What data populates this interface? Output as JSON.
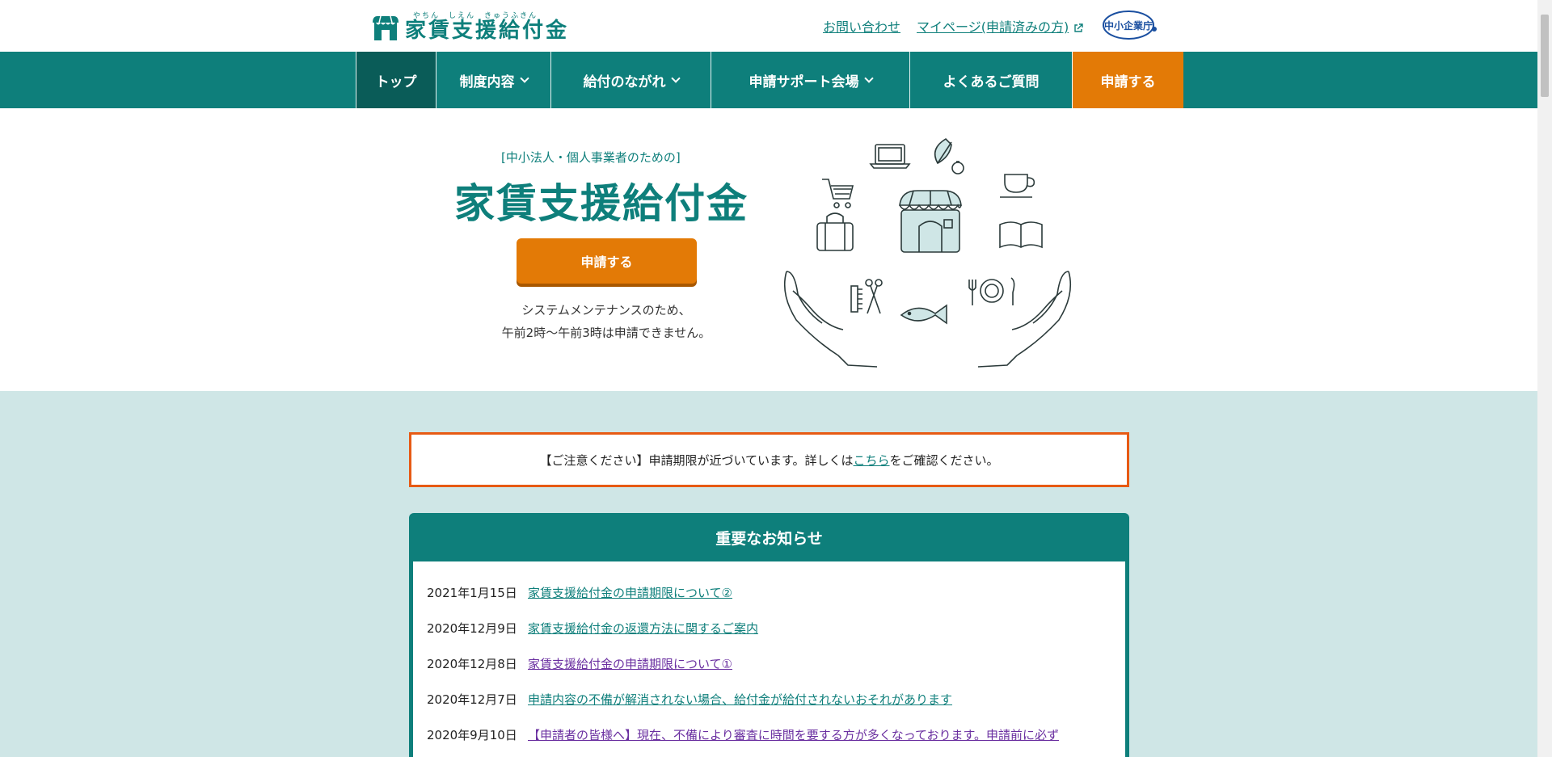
{
  "header": {
    "logo_ruby": "やちん　しえん　きゅうふきん",
    "logo_title": "家賃支援給付金",
    "contact_link": "お問い合わせ",
    "mypage_link": "マイページ(申請済みの方)",
    "agency_badge": "中小企業庁"
  },
  "nav": {
    "items": [
      {
        "label": "トップ"
      },
      {
        "label": "制度内容"
      },
      {
        "label": "給付のながれ"
      },
      {
        "label": "申請サポート会場"
      },
      {
        "label": "よくあるご質問"
      },
      {
        "label": "申請する"
      }
    ],
    "active_color": "#0a5c58",
    "bar_color": "#0e7f7b",
    "apply_color": "#e37a06"
  },
  "hero": {
    "subtitle": "[中小法人・個人事業者のための]",
    "title": "家賃支援給付金",
    "apply_button": "申請する",
    "note_line1": "システムメンテナンスのため、",
    "note_line2": "午前2時〜午前3時は申請できません。"
  },
  "notice": {
    "prefix": "【ご注意ください】申請期限が近づいています。詳しくは",
    "link": "こちら",
    "suffix": "をご確認ください。"
  },
  "news": {
    "title": "重要なお知らせ",
    "items": [
      {
        "date": "2021年1月15日",
        "text": "家賃支援給付金の申請期限について②"
      },
      {
        "date": "2020年12月9日",
        "text": "家賃支援給付金の返還方法に関するご案内"
      },
      {
        "date": "2020年12月8日",
        "text": "家賃支援給付金の申請期限について①"
      },
      {
        "date": "2020年12月7日",
        "text": "申請内容の不備が解消されない場合、給付金が給付されないおそれがあります"
      },
      {
        "date": "2020年9月10日",
        "text": "【申請者の皆様へ】現在、不備により審査に時間を要する方が多くなっております。申請前に必ず"
      }
    ]
  }
}
